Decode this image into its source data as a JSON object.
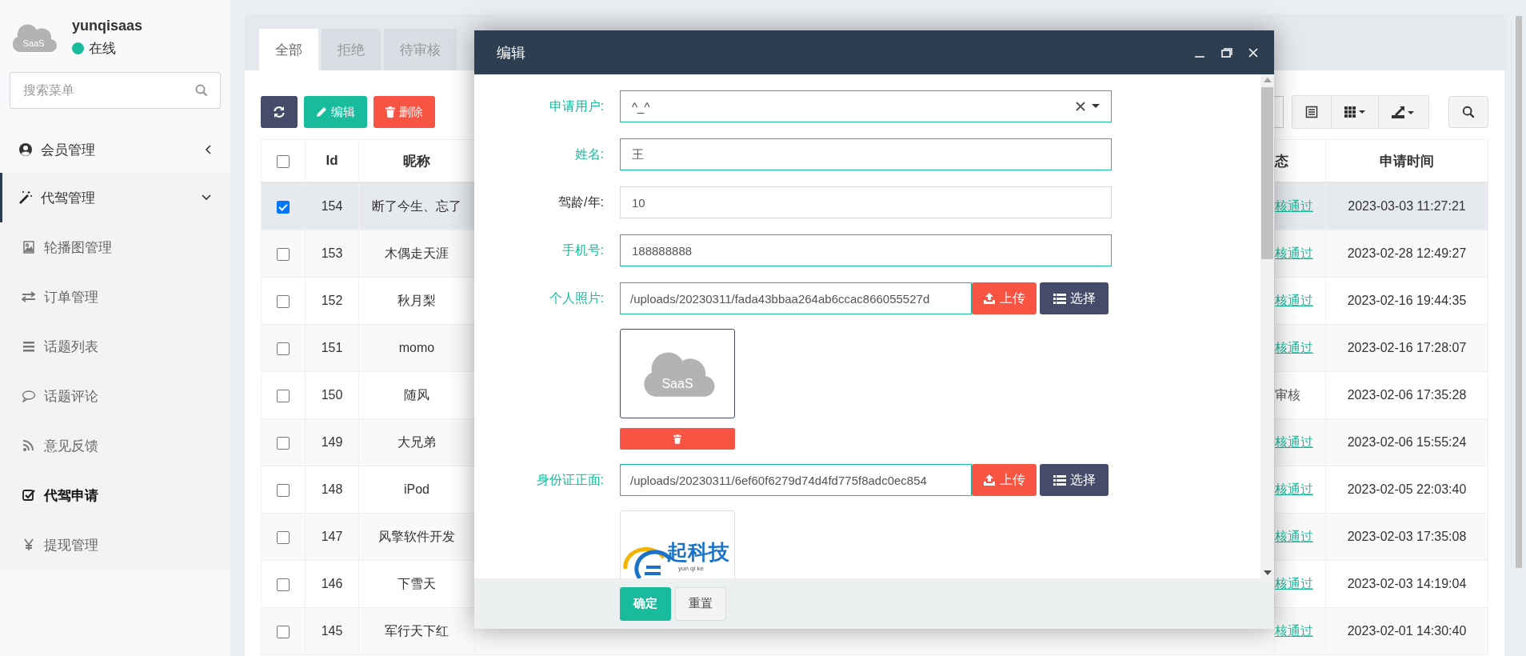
{
  "sidebar": {
    "logo_text": "SaaS",
    "user": {
      "name": "yunqisaas",
      "status": "在线",
      "online": true
    },
    "search": {
      "placeholder": "搜索菜单"
    },
    "menu": [
      {
        "label": "会员管理",
        "expanded": false,
        "selected": false
      },
      {
        "label": "代驾管理",
        "expanded": true,
        "selected": true,
        "children": [
          {
            "label": "轮播图管理",
            "selected": false
          },
          {
            "label": "订单管理",
            "selected": false
          },
          {
            "label": "话题列表",
            "selected": false
          },
          {
            "label": "话题评论",
            "selected": false
          },
          {
            "label": "意见反馈",
            "selected": false
          },
          {
            "label": "代驾申请",
            "selected": true
          },
          {
            "label": "提现管理",
            "selected": false
          }
        ]
      }
    ]
  },
  "tabs": [
    {
      "label": "全部",
      "selected": true
    },
    {
      "label": "拒绝",
      "selected": false
    },
    {
      "label": "待审核",
      "selected": false
    }
  ],
  "toolbar": {
    "buttons": [
      {
        "kind": "refresh"
      },
      {
        "kind": "edit",
        "label": "编辑"
      },
      {
        "kind": "delete",
        "label": "删除"
      }
    ]
  },
  "table": {
    "select_all": false,
    "columns": [
      "Id",
      "昵称",
      "态",
      "申请时间"
    ],
    "rows": [
      {
        "selected": true,
        "id": "154",
        "nickname": "断了今生、忘了",
        "status": "核通过",
        "approved": true,
        "time": "2023-03-03 11:27:21"
      },
      {
        "selected": false,
        "id": "153",
        "nickname": "木偶走天涯",
        "status": "核通过",
        "approved": true,
        "time": "2023-02-28 12:49:27"
      },
      {
        "selected": false,
        "id": "152",
        "nickname": "秋月梨",
        "status": "核通过",
        "approved": true,
        "time": "2023-02-16 19:44:35"
      },
      {
        "selected": false,
        "id": "151",
        "nickname": "momo",
        "status": "核通过",
        "approved": true,
        "time": "2023-02-16 17:28:07"
      },
      {
        "selected": false,
        "id": "150",
        "nickname": "随风",
        "status": "审核",
        "approved": false,
        "time": "2023-02-06 17:35:28"
      },
      {
        "selected": false,
        "id": "149",
        "nickname": "大兄弟",
        "status": "核通过",
        "approved": true,
        "time": "2023-02-06 15:55:24"
      },
      {
        "selected": false,
        "id": "148",
        "nickname": "iPod",
        "status": "核通过",
        "approved": true,
        "time": "2023-02-05 22:03:40"
      },
      {
        "selected": false,
        "id": "147",
        "nickname": "风擎软件开发",
        "status": "核通过",
        "approved": true,
        "time": "2023-02-03 17:35:08"
      },
      {
        "selected": false,
        "id": "146",
        "nickname": "下雪天",
        "status": "核通过",
        "approved": true,
        "time": "2023-02-03 14:19:04"
      },
      {
        "selected": false,
        "id": "145",
        "nickname": "军行天下红",
        "status": "核通过",
        "approved": true,
        "time": "2023-02-01 14:30:40"
      }
    ]
  },
  "dialog": {
    "title": "编辑",
    "fields": [
      {
        "kind": "select",
        "label": "申请用户:",
        "value": "^_^",
        "valid": true
      },
      {
        "kind": "text",
        "label": "姓名:",
        "value": "王",
        "valid": true
      },
      {
        "kind": "text",
        "label": "驾龄/年:",
        "value": "10",
        "valid": false
      },
      {
        "kind": "text",
        "label": "手机号:",
        "value": "188888888",
        "valid": true
      },
      {
        "kind": "upload",
        "label": "个人照片:",
        "value": "/uploads/20230311/fada43bbaa264ab6ccac866055527d",
        "valid": true,
        "upload_label": "上传",
        "choose_label": "选择",
        "removable": true,
        "preview": {
          "kind": "cloud",
          "text": "SaaS"
        }
      },
      {
        "kind": "upload",
        "label": "身份证正面:",
        "value": "/uploads/20230311/6ef60f6279d74d4fd775f8adc0ec854",
        "valid": true,
        "upload_label": "上传",
        "choose_label": "选择",
        "removable": false,
        "preview": {
          "kind": "brand",
          "text": "起科技",
          "subtext": "yun qi ke"
        }
      }
    ],
    "buttons": [
      {
        "kind": "primary",
        "label": "确定"
      },
      {
        "kind": "default",
        "label": "重置"
      }
    ]
  }
}
